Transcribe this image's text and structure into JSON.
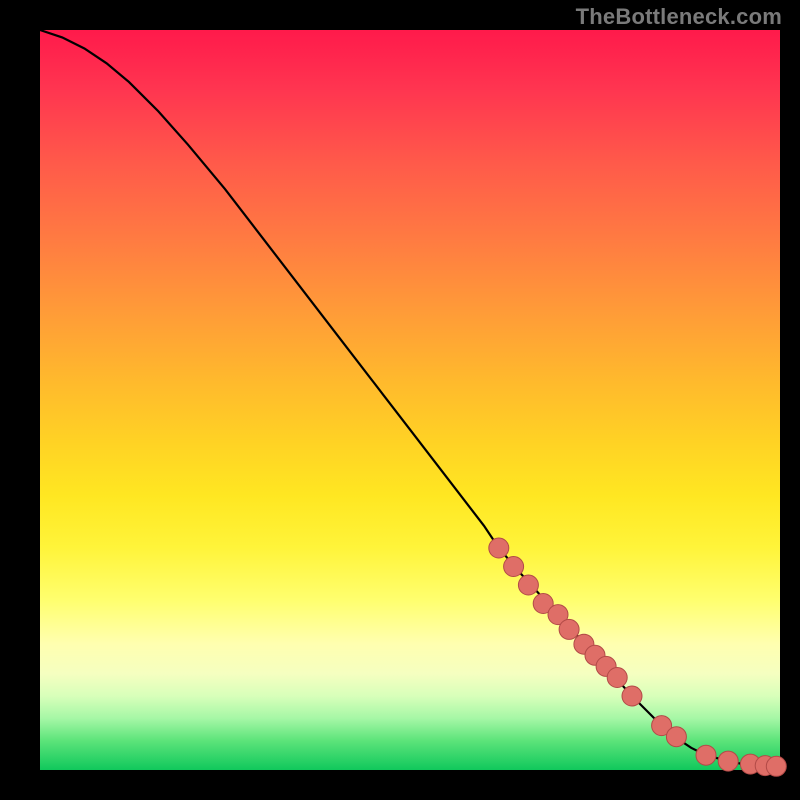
{
  "watermark": "TheBottleneck.com",
  "colors": {
    "page_bg": "#000000",
    "curve": "#000000",
    "marker_fill": "#df6e67",
    "marker_stroke": "#b24a47"
  },
  "chart_data": {
    "type": "line",
    "title": "",
    "xlabel": "",
    "ylabel": "",
    "xlim": [
      0,
      100
    ],
    "ylim": [
      0,
      100
    ],
    "grid": false,
    "series": [
      {
        "name": "curve",
        "x": [
          0,
          3,
          6,
          9,
          12,
          16,
          20,
          25,
          30,
          35,
          40,
          45,
          50,
          55,
          60,
          62,
          65,
          70,
          75,
          80,
          85,
          88,
          90,
          93,
          95,
          98,
          100
        ],
        "y": [
          100,
          99,
          97.5,
          95.5,
          93,
          89,
          84.5,
          78.5,
          72,
          65.5,
          59,
          52.5,
          46,
          39.5,
          33,
          30,
          26.5,
          21,
          15.5,
          10,
          5,
          3,
          2,
          1.2,
          0.8,
          0.5,
          0.4
        ]
      }
    ],
    "markers": {
      "name": "highlighted-points",
      "x": [
        62,
        64,
        66,
        68,
        70,
        71.5,
        73.5,
        75,
        76.5,
        78,
        80,
        84,
        86,
        90,
        93,
        96,
        98,
        99.5
      ],
      "y": [
        30,
        27.5,
        25,
        22.5,
        21,
        19,
        17,
        15.5,
        14,
        12.5,
        10,
        6,
        4.5,
        2,
        1.2,
        0.8,
        0.6,
        0.5
      ]
    }
  }
}
